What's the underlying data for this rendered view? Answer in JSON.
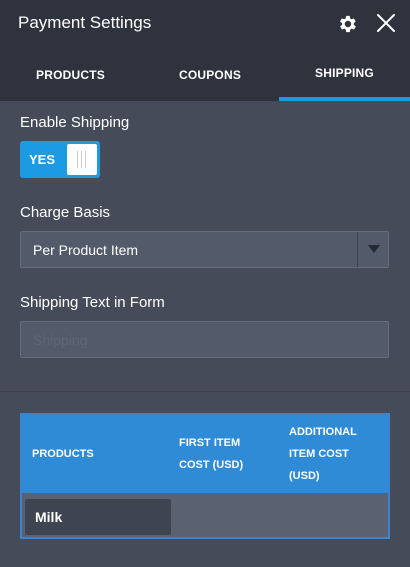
{
  "header": {
    "title": "Payment Settings",
    "settings_icon": "gear-icon",
    "close_icon": "close-icon"
  },
  "tabs": [
    {
      "label": "PRODUCTS",
      "active": false
    },
    {
      "label": "COUPONS",
      "active": false
    },
    {
      "label": "SHIPPING",
      "active": true
    }
  ],
  "enable_shipping": {
    "label": "Enable Shipping",
    "toggle_value": "YES",
    "enabled": true
  },
  "charge_basis": {
    "label": "Charge Basis",
    "selected": "Per Product Item"
  },
  "shipping_text": {
    "label": "Shipping Text in Form",
    "value": "",
    "placeholder": "Shipping"
  },
  "table": {
    "headers": [
      "PRODUCTS",
      "FIRST ITEM COST (USD)",
      "ADDITIONAL ITEM COST (USD)"
    ],
    "rows": [
      {
        "product": "Milk",
        "first_item_cost": "",
        "additional_item_cost": ""
      }
    ]
  },
  "colors": {
    "accent": "#1c9ae2",
    "header_bg": "#2f333d",
    "panel_bg": "#454b58",
    "table_header_bg": "#2f8bd6"
  }
}
